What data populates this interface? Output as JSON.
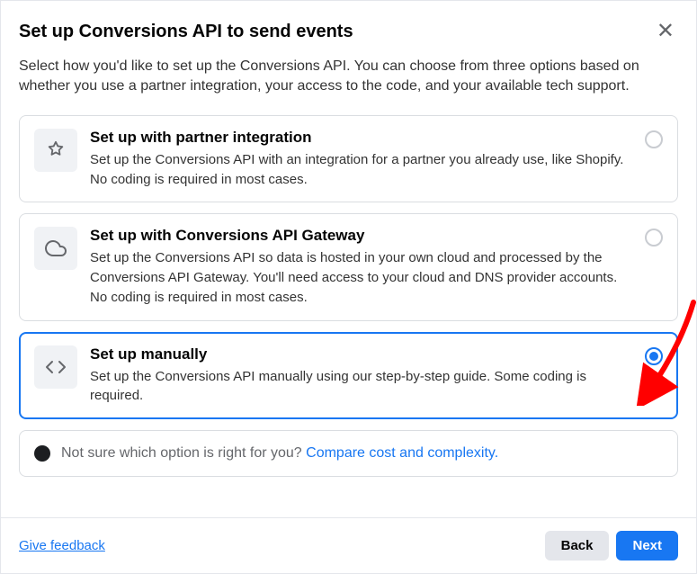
{
  "header": {
    "title": "Set up Conversions API to send events"
  },
  "intro": "Select how you'd like to set up the Conversions API. You can choose from three options based on whether you use a partner integration, your access to the code, and your available tech support.",
  "options": [
    {
      "title": "Set up with partner integration",
      "desc": "Set up the Conversions API with an integration for a partner you already use, like Shopify. No coding is required in most cases.",
      "selected": false
    },
    {
      "title": "Set up with Conversions API Gateway",
      "desc": "Set up the Conversions API so data is hosted in your own cloud and processed by the Conversions API Gateway. You'll need access to your cloud and DNS provider accounts. No coding is required in most cases.",
      "selected": false
    },
    {
      "title": "Set up manually",
      "desc": "Set up the Conversions API manually using our step-by-step guide. Some coding is required.",
      "selected": true
    }
  ],
  "info": {
    "text": "Not sure which option is right for you? ",
    "link": "Compare cost and complexity."
  },
  "footer": {
    "feedback": "Give feedback",
    "back": "Back",
    "next": "Next"
  }
}
